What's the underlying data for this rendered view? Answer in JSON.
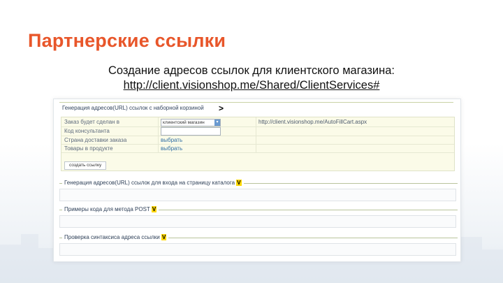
{
  "slide": {
    "title": "Партнерские ссылки",
    "subtitle": "Создание адресов ссылок для клиентского магазина:",
    "url": "http://client.visionshop.me/Shared/ClientServices#"
  },
  "panel": {
    "section1": {
      "header": "Генерация адресов(URL) ссылок с наборной корзиной",
      "caret": ">",
      "rows": [
        {
          "label": "Заказ будет сделан в",
          "select_value": "клиентский магазин",
          "result_url": "http://client.visionshop.me/AutoFillCart.aspx"
        },
        {
          "label": "Код консультанта"
        },
        {
          "label": "Страна доставки заказа",
          "link": "выбрать"
        },
        {
          "label": "Товары в продукте",
          "link": "выбрать"
        }
      ],
      "create_button": "создать ссылку"
    },
    "section2": {
      "header": "Генерация адресов(URL) ссылок для входа на страницу каталога",
      "mark": "V"
    },
    "section3": {
      "header": "Примеры кода для метода POST",
      "mark": "V"
    },
    "section4": {
      "header": "Проверка синтаксиса адреса ссылки",
      "mark": "V"
    }
  },
  "colors": {
    "title": "#e8562a",
    "form_background": "#fbfbe8",
    "link": "#2f6da3",
    "marker": "#ffd800"
  }
}
